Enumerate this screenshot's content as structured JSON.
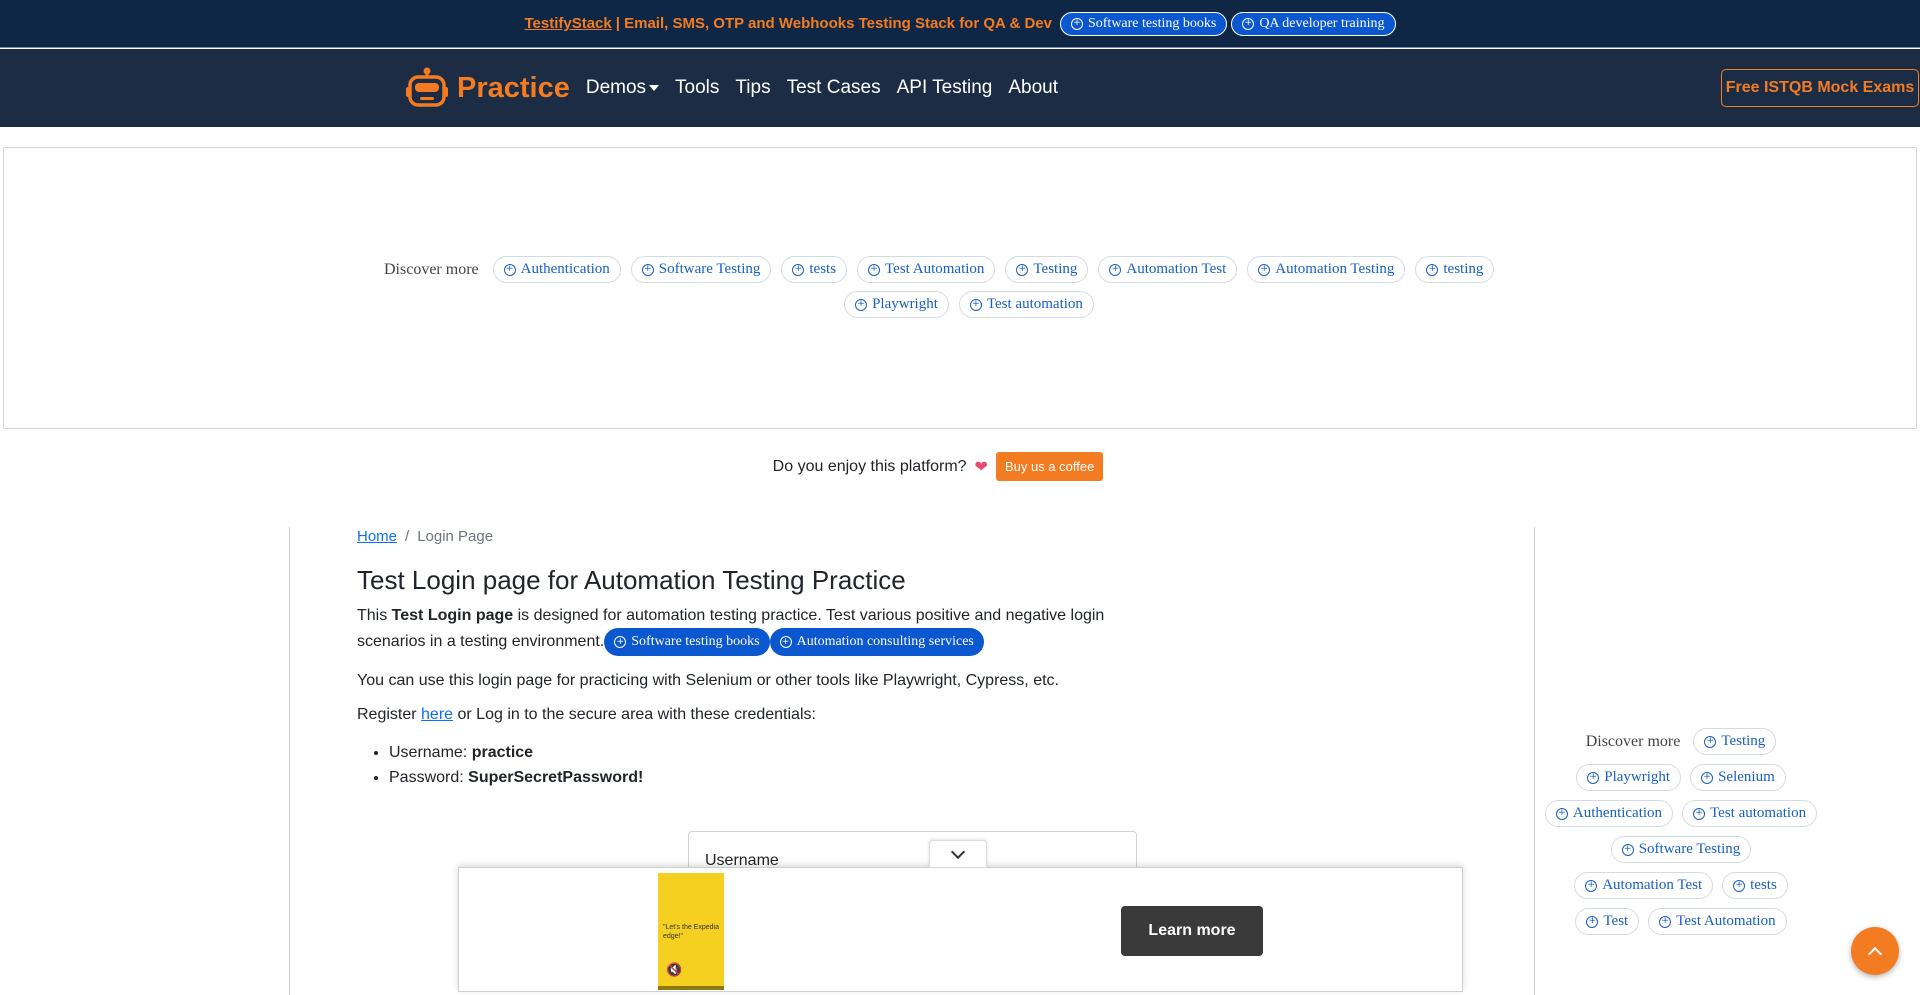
{
  "promo": {
    "brand": "TestifyStack",
    "tagline": "| Email, SMS, OTP and Webhooks Testing Stack for QA & Dev",
    "chips": [
      "Software testing books",
      "QA developer training"
    ]
  },
  "nav": {
    "logo": "Practice",
    "links": [
      "Demos",
      "Tools",
      "Tips",
      "Test Cases",
      "API Testing",
      "About"
    ],
    "cta": "Free ISTQB Mock Exams"
  },
  "discover_top": {
    "label": "Discover more",
    "row1": [
      "Authentication",
      "Software Testing",
      "tests",
      "Test Automation",
      "Testing",
      "Automation Test",
      "Automation Testing",
      "testing"
    ],
    "row2": [
      "Playwright",
      "Test automation"
    ]
  },
  "coffee": {
    "question": "Do you enjoy this platform?",
    "heart": "❤",
    "button": "Buy us a coffee"
  },
  "breadcrumb": {
    "home": "Home",
    "separator": "/",
    "current": "Login Page"
  },
  "main": {
    "title": "Test Login page for Automation Testing Practice",
    "desc_before": "This ",
    "desc_bold": "Test Login page",
    "desc_after": " is designed for automation testing practice. Test various positive and negative login scenarios in a testing environment.",
    "desc_chips": [
      "Software testing books",
      "Automation consulting services"
    ],
    "tools_para": "You can use this login page for practicing with Selenium or other tools like Playwright, Cypress, etc.",
    "register_before": "Register ",
    "register_link": "here",
    "register_after": " or Log in to the secure area with these credentials:",
    "username_label": "Username: ",
    "username_value": "practice",
    "password_label": "Password: ",
    "password_value": "SuperSecretPassword!",
    "form_username_label": "Username"
  },
  "bottom_ad": {
    "image_text": "\"Let's the Expedia edge!\"",
    "button": "Learn more"
  },
  "discover_side": {
    "label": "Discover more",
    "rows": [
      [
        "Testing"
      ],
      [
        "Playwright",
        "Selenium"
      ],
      [
        "Authentication",
        "Test automation"
      ],
      [
        "Software Testing"
      ],
      [
        "Automation Test",
        "tests"
      ],
      [
        "Test",
        "Test Automation"
      ]
    ]
  },
  "colors": {
    "navy": "#1b2c44",
    "orange": "#f37c22",
    "chip_blue": "#0b57d0"
  }
}
